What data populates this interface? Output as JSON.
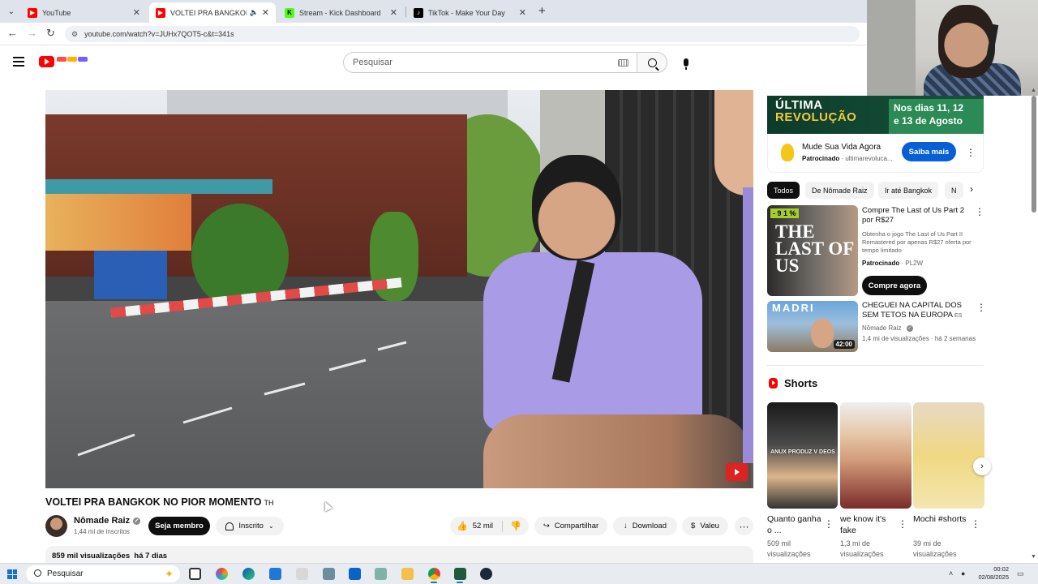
{
  "browser": {
    "tabs": [
      {
        "title": "YouTube",
        "favicon_color": "#ff0000",
        "active": false
      },
      {
        "title": "VOLTEI PRA BANGKOK NO",
        "favicon_color": "#ff0000",
        "active": true
      },
      {
        "title": "Stream - Kick Dashboard",
        "favicon_color": "#53fc18",
        "active": false
      },
      {
        "title": "TikTok - Make Your Day",
        "favicon_color": "#000000",
        "active": false
      }
    ],
    "url": "youtube.com/watch?v=JUHx7QOT5-c&t=341s"
  },
  "header": {
    "search_placeholder": "Pesquisar",
    "icons": [
      "menu-icon",
      "youtube-logo",
      "keyboard-icon",
      "search-icon",
      "mic-icon"
    ]
  },
  "video": {
    "title": "VOLTEI PRA BANGKOK NO PIOR MOMENTO",
    "title_flag": "TH",
    "channel": "Nômade Raiz",
    "subscribers": "1,44 mi de inscritos",
    "join_label": "Seja membro",
    "subscribed_label": "Inscrito",
    "likes": "52 mil",
    "share_label": "Compartilhar",
    "download_label": "Download",
    "thanks_label": "Valeu",
    "views": "859 mil visualizações",
    "age": "há 7 dias"
  },
  "sidebar": {
    "ad": {
      "banner_line1": "ÚLTIMA",
      "banner_line2": "REVOLUÇÃO",
      "banner_dates_1": "Nos dias 11, 12",
      "banner_dates_2": "e 13 de Agosto",
      "title": "Mude Sua Vida Agora",
      "sponsored": "Patrocinado",
      "domain": "· ultimarevoluca...",
      "cta": "Saiba mais"
    },
    "chips": [
      "Todos",
      "De Nômade Raiz",
      "Ir até Bangkok",
      "N"
    ],
    "recs": [
      {
        "discount": "- 9 1 %",
        "thumb_text": "THE LAST OF US",
        "title": "Compre The Last of Us Part 2 por R$27",
        "description": "Obtenha o jogo The Last of Us Part II Remastered por apenas R$27 oferta por tempo limitado",
        "sponsored": "Patrocinado",
        "advertiser": "· PL2W",
        "cta": "Compre agora"
      },
      {
        "thumb_text": "MADRI",
        "title": "CHEGUEI NA CAPITAL DOS SEM TETOS NA EUROPA",
        "title_flag": "ES",
        "channel": "Nômade Raiz",
        "meta": "1,4 mi de visualizações · há 2 semanas",
        "duration": "42:00"
      }
    ],
    "shorts_heading": "Shorts",
    "shorts": [
      {
        "title": "Quanto ganha o ...",
        "views": "509 mil visualizações",
        "caption": "ANUX PRODUZ V DEOS"
      },
      {
        "title": "we know it's fake",
        "views": "1,3 mi de visualizações"
      },
      {
        "title": "Mochi #shorts",
        "views": "39 mi de visualizações"
      }
    ]
  },
  "taskbar": {
    "search_label": "Pesquisar",
    "time": "00:02",
    "date": "02/08/2025"
  },
  "colors": {
    "youtube_red": "#ff0000",
    "cta_blue": "#065fd4",
    "chip_dark": "#0f0f0f"
  }
}
